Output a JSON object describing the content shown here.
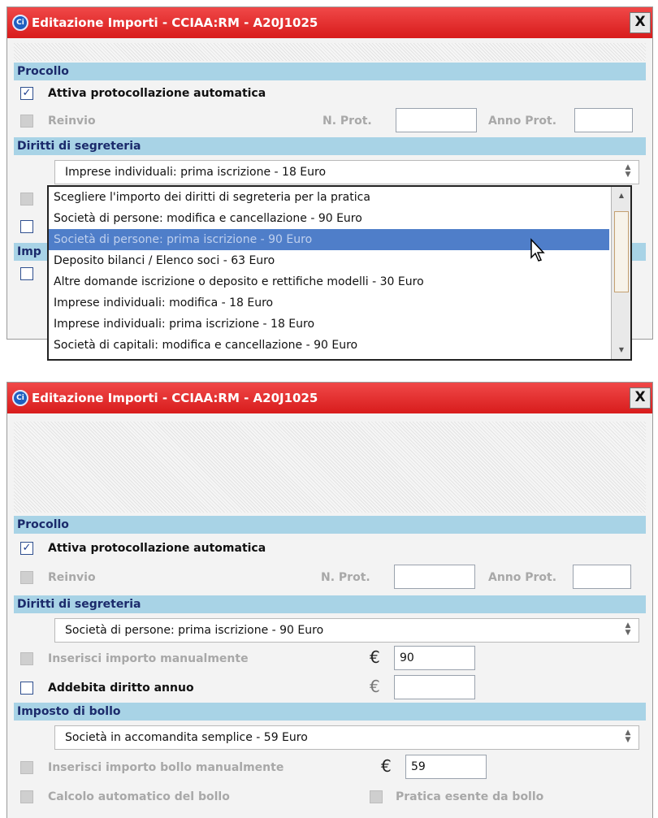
{
  "panel_top": {
    "title": "Editazione Importi - CCIAA:RM - A20J1025",
    "icon_text": "Ci",
    "close_label": "X",
    "protocollo": {
      "section_label": "Procollo",
      "auto_label": "Attiva protocollazione automatica",
      "auto_checked": "✓",
      "reinvio_label": "Reinvio",
      "nprot_label": "N. Prot.",
      "anno_label": "Anno Prot."
    },
    "diritti": {
      "section_label": "Diritti di segreteria",
      "selected": "Imprese individuali: prima iscrizione - 18 Euro"
    },
    "hidden_section_label": "Imp",
    "dropdown_options": [
      "Scegliere l'importo dei diritti di segreteria per la pratica",
      "Società di persone: modifica e cancellazione - 90 Euro",
      "Società di persone: prima iscrizione - 90 Euro",
      "Deposito bilanci / Elenco soci - 63 Euro",
      "Altre domande iscrizione o deposito e rettifiche modelli - 30 Euro",
      "Imprese individuali: modifica - 18 Euro",
      "Imprese individuali: prima iscrizione - 18 Euro",
      "Società di capitali: modifica e cancellazione - 90 Euro"
    ],
    "highlighted_option_index": 2
  },
  "panel_bottom": {
    "title": "Editazione Importi - CCIAA:RM - A20J1025",
    "icon_text": "Ci",
    "close_label": "X",
    "protocollo": {
      "section_label": "Procollo",
      "auto_label": "Attiva protocollazione automatica",
      "auto_checked": "✓",
      "reinvio_label": "Reinvio",
      "nprot_label": "N. Prot.",
      "anno_label": "Anno Prot."
    },
    "diritti": {
      "section_label": "Diritti di segreteria",
      "selected": "Società di persone: prima iscrizione - 90 Euro",
      "manual_label": "Inserisci importo manualmente",
      "amount_value": "90",
      "annuo_label": "Addebita diritto annuo",
      "annuo_value": ""
    },
    "bollo": {
      "section_label": "Imposto di bollo",
      "selected": "Società in accomandita semplice - 59 Euro",
      "manual_label": "Inserisci importo bollo manualmente",
      "amount_value": "59",
      "auto_label": "Calcolo automatico del bollo",
      "exempt_label": "Pratica esente da bollo"
    },
    "currency_symbol": "€"
  },
  "colors": {
    "titlebar": "#e02828",
    "section_bg": "#a8d3e6",
    "section_text": "#1b2a6b",
    "highlight": "#4f7ec9"
  }
}
